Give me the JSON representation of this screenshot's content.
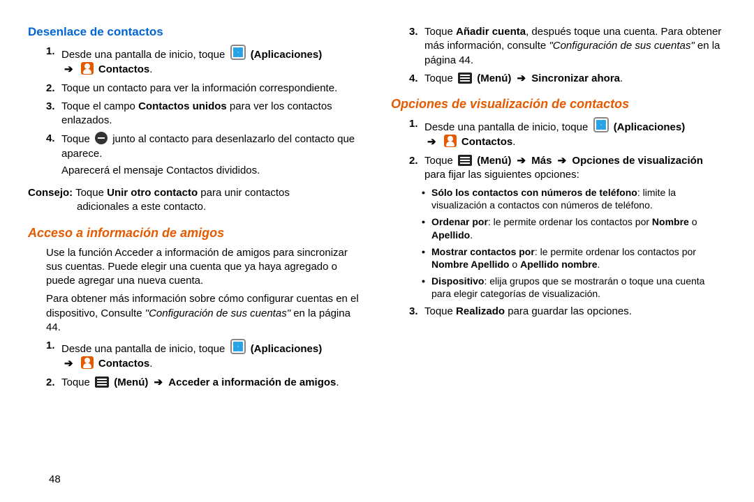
{
  "pageNumber": "48",
  "left": {
    "h1": "Desenlace de contactos",
    "step1a": "Desde una pantalla de inicio, toque ",
    "apps": "(Aplicaciones)",
    "contacts": "Contactos",
    "step2": "Toque un contacto para ver la información correspondiente.",
    "step3a": "Toque el campo ",
    "step3b": "Contactos unidos",
    "step3c": " para ver los contactos enlazados.",
    "step4a": "Toque ",
    "step4b": " junto al contacto para desenlazarlo del contacto que aparece.",
    "step4sub": "Aparecerá el mensaje Contactos divididos.",
    "tipLbl": "Consejo:",
    "tipA": " Toque ",
    "tipB": "Unir otro contacto",
    "tipC": " para unir contactos",
    "tipD": "adicionales a este contacto.",
    "h2": "Acceso a información de amigos",
    "p1": "Use la función Acceder a información de amigos para sincronizar sus cuentas. Puede elegir una cuenta que ya haya agregado o puede agregar una nueva cuenta.",
    "p2a": "Para obtener más información sobre cómo configurar cuentas en el dispositivo, Consulte ",
    "p2ref": "\"Configuración de sus cuentas\"",
    "p2b": " en la página 44.",
    "s2": "Toque ",
    "s2menu": "(Menú)",
    "s2b": "Acceder a información de amigos"
  },
  "right": {
    "step3a": "Toque ",
    "step3b": "Añadir cuenta",
    "step3c": ", después toque una cuenta. Para obtener más información, consulte ",
    "step3ref": "\"Configuración de sus cuentas\"",
    "step3d": " en la página 44.",
    "step4a": "Toque ",
    "step4menu": "(Menú)",
    "step4b": "Sincronizar ahora",
    "h1": "Opciones de visualización de contactos",
    "s1": "Desde una pantalla de inicio, toque ",
    "apps": "(Aplicaciones)",
    "contacts": "Contactos",
    "s2a": "Toque ",
    "s2menu": "(Menú)",
    "s2more": "Más",
    "s2opt": "Opciones de visualización",
    "s2b": " para fijar las siguientes opciones:",
    "b1a": "Sólo los contactos con números de teléfono",
    "b1b": ": limite la visualización a contactos con números de teléfono.",
    "b2a": "Ordenar por",
    "b2b": ": le permite ordenar los contactos por ",
    "b2c": "Nombre",
    "b2d": " o ",
    "b2e": "Apellido",
    "b3a": "Mostrar contactos por",
    "b3b": ": le permite ordenar los contactos por ",
    "b3c": "Nombre Apellido",
    "b3d": " o ",
    "b3e": "Apellido nombre",
    "b4a": "Dispositivo",
    "b4b": ": elija grupos que se mostrarán o toque una cuenta para elegir categorías de visualización.",
    "s3a": "Toque ",
    "s3b": "Realizado",
    "s3c": " para guardar las opciones."
  }
}
